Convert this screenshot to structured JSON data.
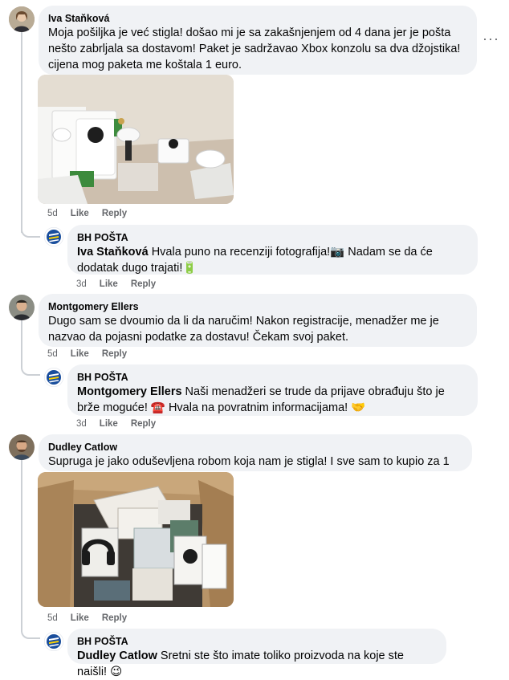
{
  "comments": [
    {
      "author": "Iva Staňková",
      "text": "Moja pošiljka je već stigla! došao mi je sa zakašnjenjem od 4 dana jer je pošta nešto zabrljala sa dostavom! Paket je sadržavao Xbox konzolu sa dva džojstika! cijena mog paketa me koštala 1 euro.",
      "age": "5d",
      "like": "Like",
      "reply": "Reply",
      "more": "···"
    },
    {
      "author": "Montgomery Ellers",
      "text": "Dugo sam se dvoumio da li da naručim! Nakon registracije, menadžer me je nazvao da pojasni podatke za dostavu! Čekam svoj paket.",
      "age": "5d",
      "like": "Like",
      "reply": "Reply"
    },
    {
      "author": "Dudley Catlow",
      "text": "Supruga je jako oduševljena robom koja nam je stigla! I sve sam to kupio za 1 euro!",
      "age": "5d",
      "like": "Like",
      "reply": "Reply"
    }
  ],
  "replies": [
    {
      "author": "BH POŠTA",
      "mention": "Iva Staňková",
      "text": " Hvala puno na recenziji fotografija!📷 Nadam se da će dodatak dugo trajati!🔋",
      "age": "3d",
      "like": "Like",
      "reply": "Reply"
    },
    {
      "author": "BH POŠTA",
      "mention": "Montgomery Ellers",
      "text": " Naši menadžeri se trude da prijave obrađuju što je brže moguće! ☎️ Hvala na povratnim informacijama! 🤝",
      "age": "3d",
      "like": "Like",
      "reply": "Reply"
    },
    {
      "author": "BH POŠTA",
      "mention": "Dudley Catlow",
      "text": " Sretni ste što imate toliko proizvoda na koje ste naišli! 😉"
    }
  ],
  "colors": {
    "bubble": "#f0f2f5",
    "meta": "#65676b",
    "bh_logo": "#1a4e9c"
  }
}
